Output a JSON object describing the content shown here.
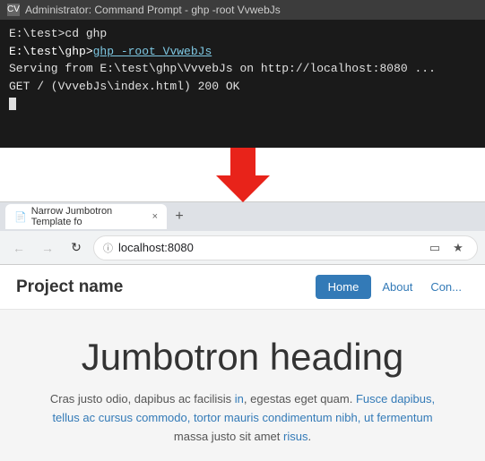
{
  "terminal": {
    "titlebar": {
      "icon_label": "CV",
      "title": "Administrator: Command Prompt - ghp  -root VvwebJs"
    },
    "lines": [
      {
        "id": "line1",
        "prefix": "E:\\test>",
        "command": "cd ghp"
      },
      {
        "id": "line2",
        "prefix": "E:\\test\\ghp>",
        "command": "ghp -root VvwebJs",
        "underline": true
      },
      {
        "id": "line3",
        "text": "Serving from E:\\test\\ghp\\VvvebJs on http://localhost:8080 ..."
      },
      {
        "id": "line4",
        "text": "GET / (VvvebJs\\index.html) 200 OK"
      }
    ]
  },
  "arrow": {
    "color": "#e8231a"
  },
  "browser": {
    "tab": {
      "label": "Narrow Jumbotron Template fo",
      "close": "×",
      "new_tab": "+"
    },
    "address": "localhost:8080",
    "nav": {
      "back": "←",
      "forward": "→",
      "reload": "↻"
    }
  },
  "webpage": {
    "navbar": {
      "brand": "Project name",
      "home_btn": "Home",
      "about_link": "About",
      "contact_link": "Con..."
    },
    "hero": {
      "heading": "Jumbotron heading",
      "text": "Cras justo odio, dapibus ac facilisis in, egestas eget quam. Fusce dapibus, tellus ac cursus commodo, tortor mauris condimentum nibh, ut fermentum massa justo sit amet risus."
    }
  }
}
